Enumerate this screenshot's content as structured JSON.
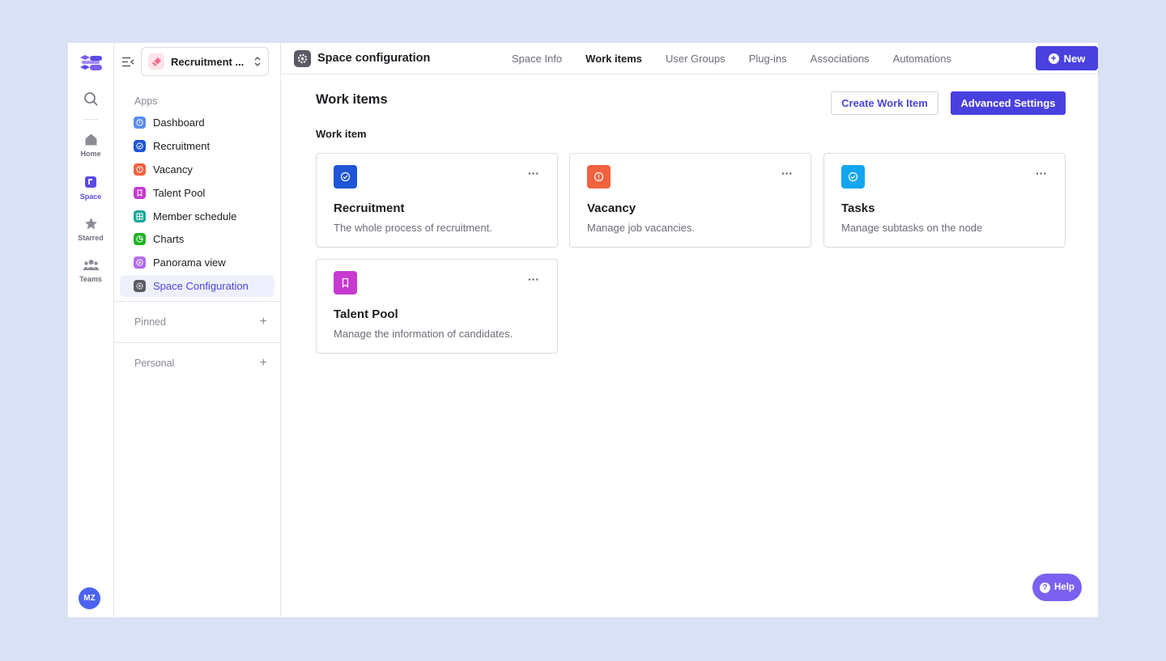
{
  "rail": {
    "items": [
      {
        "label": "Home",
        "icon": "home-icon"
      },
      {
        "label": "Space",
        "icon": "space-icon"
      },
      {
        "label": "Starred",
        "icon": "star-icon"
      },
      {
        "label": "Teams",
        "icon": "teams-icon"
      }
    ],
    "avatar": "MZ"
  },
  "sidebar": {
    "space_name": "Recruitment ...",
    "apps_label": "Apps",
    "items": [
      {
        "label": "Dashboard",
        "color": "#5b8def"
      },
      {
        "label": "Recruitment",
        "color": "#1f55d6"
      },
      {
        "label": "Vacancy",
        "color": "#f1623f"
      },
      {
        "label": "Talent Pool",
        "color": "#c63ad0"
      },
      {
        "label": "Member schedule",
        "color": "#1aa99a"
      },
      {
        "label": "Charts",
        "color": "#20b226"
      },
      {
        "label": "Panorama view",
        "color": "#b36bef"
      },
      {
        "label": "Space Configuration",
        "color": "#5a5a64"
      }
    ],
    "pinned_label": "Pinned",
    "personal_label": "Personal"
  },
  "header": {
    "title": "Space configuration",
    "tabs": [
      "Space Info",
      "Work items",
      "User Groups",
      "Plug-ins",
      "Associations",
      "Automations"
    ],
    "active_tab": "Work items",
    "new_label": "New"
  },
  "main": {
    "title": "Work items",
    "create_label": "Create Work Item",
    "advanced_label": "Advanced Settings",
    "section_label": "Work item",
    "cards": [
      {
        "title": "Recruitment",
        "desc": "The whole process of recruitment.",
        "color": "#1f55d6",
        "icon": "check-circle-icon"
      },
      {
        "title": "Vacancy",
        "desc": "Manage job vacancies.",
        "color": "#f1623f",
        "icon": "alert-circle-icon"
      },
      {
        "title": "Tasks",
        "desc": "Manage subtasks on the node",
        "color": "#13a6ee",
        "icon": "check-circle-icon"
      },
      {
        "title": "Talent Pool",
        "desc": "Manage the information of candidates.",
        "color": "#c63ad0",
        "icon": "bookmark-icon"
      }
    ]
  },
  "help_label": "Help"
}
